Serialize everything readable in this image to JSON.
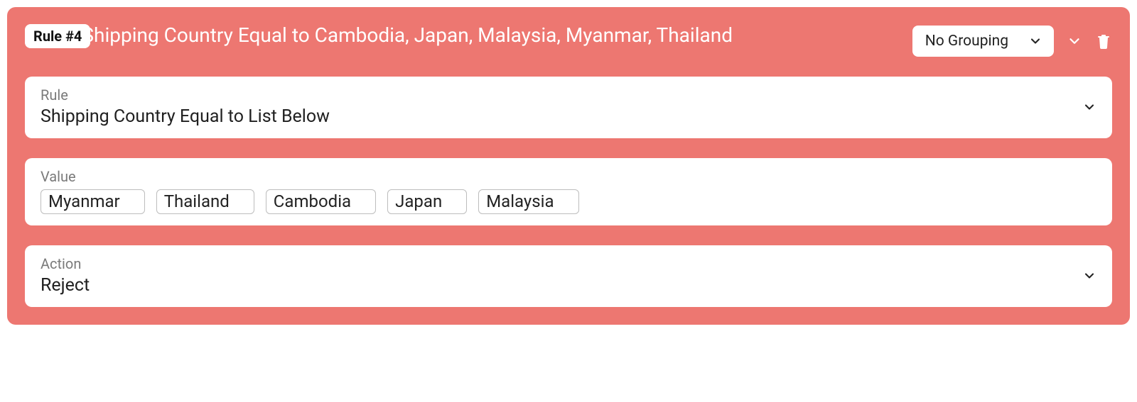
{
  "rule": {
    "badge": "Rule #4",
    "title": "Shipping Country Equal to Cambodia, Japan, Malaysia, Myanmar, Thailand",
    "grouping": {
      "selected": "No Grouping"
    },
    "fields": {
      "rule_label": "Rule",
      "rule_value": "Shipping Country Equal to List Below",
      "value_label": "Value",
      "value_chips": [
        "Myanmar",
        "Thailand",
        "Cambodia",
        "Japan",
        "Malaysia"
      ],
      "action_label": "Action",
      "action_value": "Reject"
    }
  }
}
